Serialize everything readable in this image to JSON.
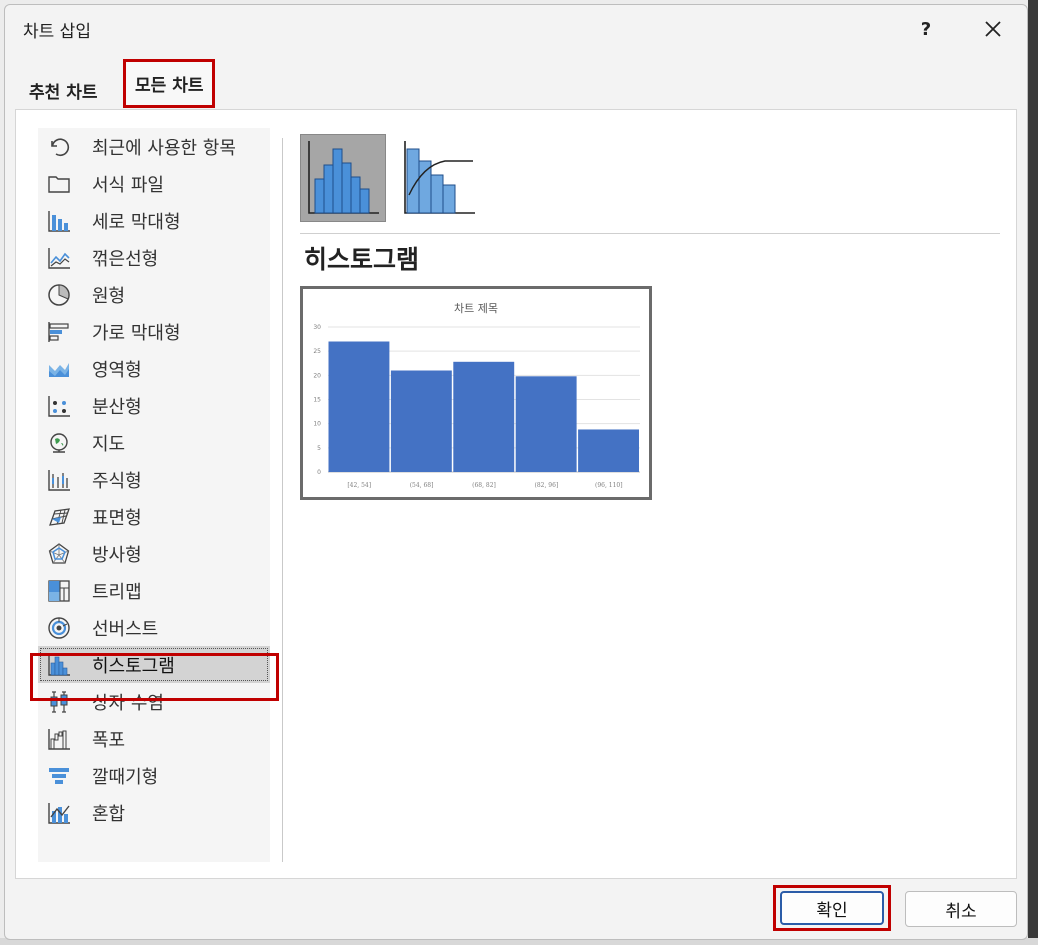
{
  "dialog": {
    "title": "차트 삽입",
    "help_label": "?",
    "close_icon": "close-icon"
  },
  "tabs": [
    {
      "label": "추천 차트",
      "active": false
    },
    {
      "label": "모든 차트",
      "active": true
    }
  ],
  "chart_types": [
    {
      "label": "최근에 사용한 항목",
      "icon": "undo-icon"
    },
    {
      "label": "서식 파일",
      "icon": "folder-icon"
    },
    {
      "label": "세로 막대형",
      "icon": "column-chart-icon"
    },
    {
      "label": "꺾은선형",
      "icon": "line-chart-icon"
    },
    {
      "label": "원형",
      "icon": "pie-chart-icon"
    },
    {
      "label": "가로 막대형",
      "icon": "bar-chart-icon"
    },
    {
      "label": "영역형",
      "icon": "area-chart-icon"
    },
    {
      "label": "분산형",
      "icon": "scatter-chart-icon"
    },
    {
      "label": "지도",
      "icon": "globe-icon"
    },
    {
      "label": "주식형",
      "icon": "stock-chart-icon"
    },
    {
      "label": "표면형",
      "icon": "surface-chart-icon"
    },
    {
      "label": "방사형",
      "icon": "radar-chart-icon"
    },
    {
      "label": "트리맵",
      "icon": "treemap-icon"
    },
    {
      "label": "선버스트",
      "icon": "sunburst-icon"
    },
    {
      "label": "히스토그램",
      "icon": "histogram-icon",
      "selected": true
    },
    {
      "label": "상자 수염",
      "icon": "box-whisker-icon"
    },
    {
      "label": "폭포",
      "icon": "waterfall-icon"
    },
    {
      "label": "깔때기형",
      "icon": "funnel-icon"
    },
    {
      "label": "혼합",
      "icon": "combo-chart-icon"
    }
  ],
  "selected_type": {
    "name": "히스토그램",
    "subtypes": [
      {
        "name": "histogram",
        "icon": "histogram-subtype-icon",
        "selected": true
      },
      {
        "name": "pareto",
        "icon": "pareto-subtype-icon",
        "selected": false
      }
    ]
  },
  "colors": {
    "highlight_red": "#c00000",
    "bar_blue": "#4472c4",
    "icon_blue": "#4a90d9"
  },
  "chart_data": {
    "type": "bar",
    "title": "차트 제목",
    "categories": [
      "[42, 54]",
      "(54, 68]",
      "(68, 82]",
      "(82, 96]",
      "(96, 110]"
    ],
    "values": [
      27,
      21,
      22.8,
      19.8,
      8.8
    ],
    "ylim": [
      0,
      30
    ],
    "yticks": [
      "0",
      "5",
      "10",
      "15",
      "20",
      "25",
      "30"
    ],
    "grid": true
  },
  "buttons": {
    "ok": "확인",
    "cancel": "취소"
  }
}
